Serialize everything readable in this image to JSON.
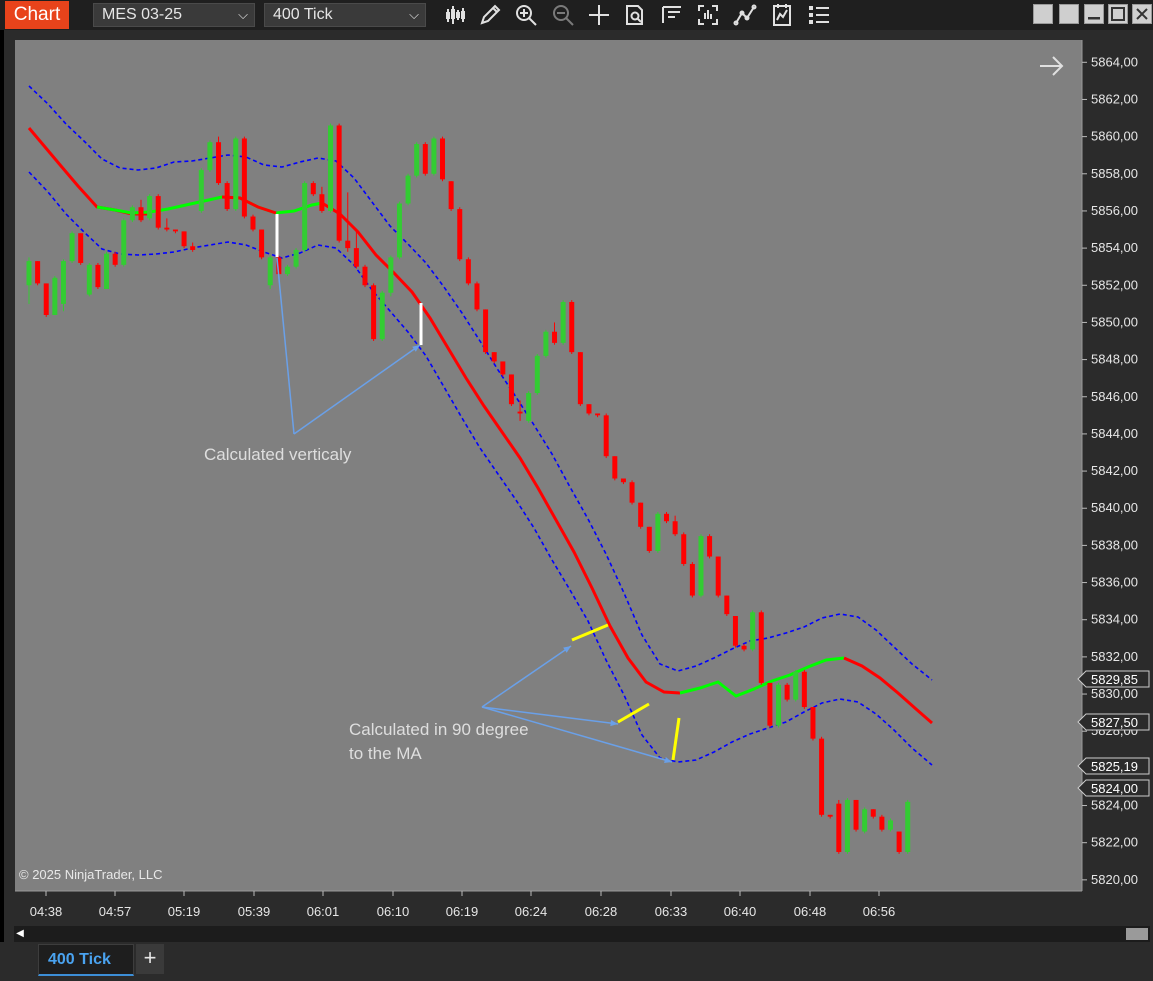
{
  "toolbar": {
    "chart_tab": "Chart",
    "instrument": "MES 03-25",
    "interval": "400 Tick",
    "icons": [
      "bar-type-icon",
      "drawing-tool-icon",
      "zoom-in-icon",
      "zoom-out-icon",
      "crosshair-icon",
      "data-box-icon",
      "chart-trader-icon",
      "templates-icon",
      "strategies-icon",
      "indicators-icon",
      "properties-icon"
    ]
  },
  "chart": {
    "copyright": "© 2025 NinjaTrader, LLC",
    "annotation_vertical": "Calculated verticaly",
    "annotation_perpendicular_line1": "Calculated in 90 degree",
    "annotation_perpendicular_line2": "to the MA",
    "price_tags": {
      "upper_band": "5829,85",
      "ma": "5827,50",
      "lower_band": "5825,19",
      "last": "5824,00"
    },
    "colors": {
      "up_bar": "#33cc33",
      "down_bar": "#ff0000",
      "ma_down": "#ff0000",
      "ma_up": "#00ff00",
      "bands": "#0000ff",
      "background": "#808080",
      "marker": "#ffff00",
      "annotation": "#6aa0e8"
    }
  },
  "chart_data": {
    "type": "candlestick",
    "title": "",
    "y_ticks": [
      "5864,00",
      "5862,00",
      "5860,00",
      "5858,00",
      "5856,00",
      "5854,00",
      "5852,00",
      "5850,00",
      "5848,00",
      "5846,00",
      "5844,00",
      "5842,00",
      "5840,00",
      "5838,00",
      "5836,00",
      "5834,00",
      "5832,00",
      "5830,00",
      "5828,00",
      "5826,00",
      "5824,00",
      "5822,00",
      "5820,00"
    ],
    "x_ticks": [
      "04:38",
      "04:57",
      "05:19",
      "05:39",
      "06:01",
      "06:10",
      "06:19",
      "06:24",
      "06:28",
      "06:33",
      "06:40",
      "06:48",
      "06:56"
    ],
    "ylim": [
      5819.4,
      5865.2
    ],
    "bars": [
      [
        5852.0,
        5853.5,
        5851.0,
        5853.3
      ],
      [
        5853.3,
        5853.3,
        5852.0,
        5852.1
      ],
      [
        5852.1,
        5852.1,
        5850.3,
        5850.4
      ],
      [
        5850.4,
        5852.5,
        5850.4,
        5852.4
      ],
      [
        5851.0,
        5853.4,
        5850.6,
        5853.3
      ],
      [
        5853.3,
        5854.9,
        5853.2,
        5854.8
      ],
      [
        5854.8,
        5854.8,
        5853.1,
        5853.2
      ],
      [
        5851.5,
        5853.2,
        5851.4,
        5853.1
      ],
      [
        5853.1,
        5853.2,
        5851.8,
        5851.9
      ],
      [
        5851.8,
        5853.8,
        5851.8,
        5853.7
      ],
      [
        5853.7,
        5853.8,
        5853.0,
        5853.1
      ],
      [
        5853.1,
        5855.6,
        5853.0,
        5855.5
      ],
      [
        5855.5,
        5856.3,
        5855.4,
        5856.2
      ],
      [
        5856.2,
        5856.6,
        5855.4,
        5855.5
      ],
      [
        5855.6,
        5856.9,
        5855.5,
        5856.8
      ],
      [
        5856.8,
        5856.9,
        5855.0,
        5855.1
      ],
      [
        5855.1,
        5855.6,
        5854.9,
        5855.0
      ],
      [
        5855.0,
        5855.0,
        5854.8,
        5854.9
      ],
      [
        5854.9,
        5854.9,
        5854.0,
        5854.1
      ],
      [
        5854.1,
        5854.3,
        5853.8,
        5853.9
      ],
      [
        5856.0,
        5858.3,
        5855.9,
        5858.2
      ],
      [
        5858.2,
        5859.8,
        5858.1,
        5859.7
      ],
      [
        5859.7,
        5860.0,
        5857.4,
        5857.5
      ],
      [
        5857.5,
        5857.6,
        5856.0,
        5856.1
      ],
      [
        5856.1,
        5860.0,
        5856.0,
        5859.9
      ],
      [
        5859.9,
        5860.0,
        5855.6,
        5855.7
      ],
      [
        5855.7,
        5855.8,
        5854.9,
        5855.0
      ],
      [
        5855.0,
        5855.0,
        5853.4,
        5853.5
      ],
      [
        5852.0,
        5853.6,
        5851.8,
        5853.5
      ],
      [
        5853.5,
        5853.6,
        5852.5,
        5852.6
      ],
      [
        5852.6,
        5853.1,
        5852.5,
        5853.0
      ],
      [
        5853.0,
        5854.0,
        5852.9,
        5853.9
      ],
      [
        5853.9,
        5857.6,
        5853.8,
        5857.5
      ],
      [
        5857.5,
        5857.6,
        5856.8,
        5856.9
      ],
      [
        5856.9,
        5857.3,
        5855.9,
        5856.0
      ],
      [
        5856.0,
        5860.7,
        5855.9,
        5860.6
      ],
      [
        5860.6,
        5860.7,
        5854.3,
        5854.4
      ],
      [
        5854.4,
        5857.0,
        5853.8,
        5854.0
      ],
      [
        5854.0,
        5854.9,
        5852.9,
        5853.0
      ],
      [
        5853.0,
        5853.1,
        5851.9,
        5852.0
      ],
      [
        5852.0,
        5852.1,
        5849.0,
        5849.1
      ],
      [
        5849.1,
        5851.7,
        5849.0,
        5851.6
      ],
      [
        5851.6,
        5853.6,
        5851.4,
        5853.5
      ],
      [
        5853.5,
        5856.5,
        5853.4,
        5856.4
      ],
      [
        5856.4,
        5858.0,
        5856.3,
        5857.9
      ],
      [
        5857.9,
        5859.7,
        5857.8,
        5859.6
      ],
      [
        5859.6,
        5859.7,
        5857.9,
        5858.0
      ],
      [
        5858.0,
        5860.0,
        5857.9,
        5859.9
      ],
      [
        5859.9,
        5860.0,
        5857.6,
        5857.7
      ],
      [
        5857.6,
        5857.6,
        5856.0,
        5856.1
      ],
      [
        5856.1,
        5856.2,
        5853.3,
        5853.4
      ],
      [
        5853.4,
        5853.5,
        5852.0,
        5852.1
      ],
      [
        5852.1,
        5852.2,
        5850.6,
        5850.7
      ],
      [
        5850.7,
        5850.7,
        5848.3,
        5848.4
      ],
      [
        5848.4,
        5848.4,
        5847.8,
        5847.9
      ],
      [
        5847.9,
        5847.9,
        5847.1,
        5847.2
      ],
      [
        5847.2,
        5847.2,
        5845.5,
        5845.6
      ],
      [
        5845.2,
        5845.8,
        5844.7,
        5845.1
      ],
      [
        5844.7,
        5846.3,
        5844.6,
        5846.2
      ],
      [
        5846.2,
        5848.3,
        5846.1,
        5848.2
      ],
      [
        5848.2,
        5849.6,
        5848.1,
        5849.5
      ],
      [
        5849.5,
        5850.0,
        5848.8,
        5848.9
      ],
      [
        5848.9,
        5851.2,
        5848.8,
        5851.1
      ],
      [
        5851.1,
        5851.2,
        5848.3,
        5848.4
      ],
      [
        5848.4,
        5848.4,
        5845.5,
        5845.6
      ],
      [
        5845.6,
        5845.6,
        5845.0,
        5845.1
      ],
      [
        5845.1,
        5845.1,
        5844.9,
        5845.0
      ],
      [
        5845.0,
        5845.1,
        5842.7,
        5842.8
      ],
      [
        5842.8,
        5842.8,
        5841.5,
        5841.6
      ],
      [
        5841.6,
        5841.6,
        5841.3,
        5841.4
      ],
      [
        5841.4,
        5841.5,
        5840.2,
        5840.3
      ],
      [
        5840.3,
        5840.3,
        5838.9,
        5839.0
      ],
      [
        5839.0,
        5839.0,
        5837.6,
        5837.7
      ],
      [
        5837.7,
        5839.8,
        5837.6,
        5839.7
      ],
      [
        5839.7,
        5839.8,
        5839.2,
        5839.3
      ],
      [
        5839.3,
        5839.6,
        5838.5,
        5838.6
      ],
      [
        5838.6,
        5838.7,
        5836.9,
        5837.0
      ],
      [
        5837.0,
        5837.1,
        5835.2,
        5835.3
      ],
      [
        5835.3,
        5838.6,
        5835.2,
        5838.5
      ],
      [
        5838.5,
        5838.6,
        5837.3,
        5837.4
      ],
      [
        5837.4,
        5837.4,
        5835.2,
        5835.3
      ],
      [
        5835.3,
        5835.3,
        5834.2,
        5834.3
      ],
      [
        5834.2,
        5834.2,
        5832.5,
        5832.6
      ],
      [
        5832.6,
        5832.7,
        5832.3,
        5832.4
      ],
      [
        5832.4,
        5834.5,
        5832.3,
        5834.4
      ],
      [
        5834.4,
        5834.5,
        5830.5,
        5830.6
      ],
      [
        5830.6,
        5830.6,
        5828.2,
        5828.3
      ],
      [
        5828.3,
        5830.6,
        5828.2,
        5830.5
      ],
      [
        5830.5,
        5830.6,
        5829.6,
        5829.7
      ],
      [
        5829.7,
        5831.3,
        5829.6,
        5831.2
      ],
      [
        5831.2,
        5831.3,
        5829.2,
        5829.3
      ],
      [
        5829.3,
        5829.3,
        5827.5,
        5827.6
      ],
      [
        5827.6,
        5827.7,
        5823.4,
        5823.5
      ],
      [
        5823.5,
        5823.5,
        5823.3,
        5823.4
      ],
      [
        5824.1,
        5824.3,
        5821.4,
        5821.5
      ],
      [
        5821.5,
        5824.4,
        5821.4,
        5824.3
      ],
      [
        5824.3,
        5824.3,
        5822.6,
        5822.7
      ],
      [
        5822.6,
        5823.9,
        5822.5,
        5823.8
      ],
      [
        5823.8,
        5823.8,
        5823.3,
        5823.4
      ],
      [
        5823.4,
        5823.5,
        5822.6,
        5822.7
      ],
      [
        5822.7,
        5823.3,
        5822.6,
        5823.2
      ],
      [
        5822.6,
        5822.6,
        5821.4,
        5821.5
      ],
      [
        5821.5,
        5824.3,
        5821.4,
        5824.2
      ]
    ]
  }
}
